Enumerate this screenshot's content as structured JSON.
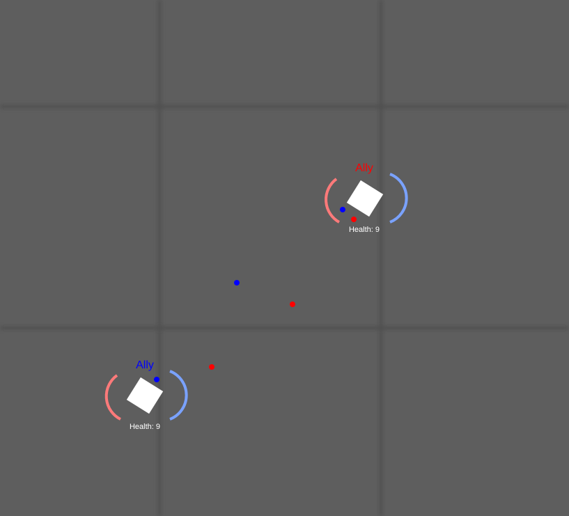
{
  "colors": {
    "background": "#5e5e5e",
    "grid_line": "#525252",
    "red_team": "#ff0000",
    "blue_team": "#0000ff",
    "red_arc": "#ff7a7a",
    "blue_arc": "#7aa2ff",
    "player_body": "#ffffff",
    "health_text": "#ffffff"
  },
  "players": [
    {
      "name": "Ally",
      "team": "red",
      "health_label": "Health: 9",
      "health": 9
    },
    {
      "name": "Ally",
      "team": "blue",
      "health_label": "Health: 9",
      "health": 9
    }
  ],
  "projectiles": [
    {
      "team": "blue"
    },
    {
      "team": "red"
    },
    {
      "team": "blue"
    },
    {
      "team": "red"
    },
    {
      "team": "blue"
    },
    {
      "team": "red"
    }
  ]
}
